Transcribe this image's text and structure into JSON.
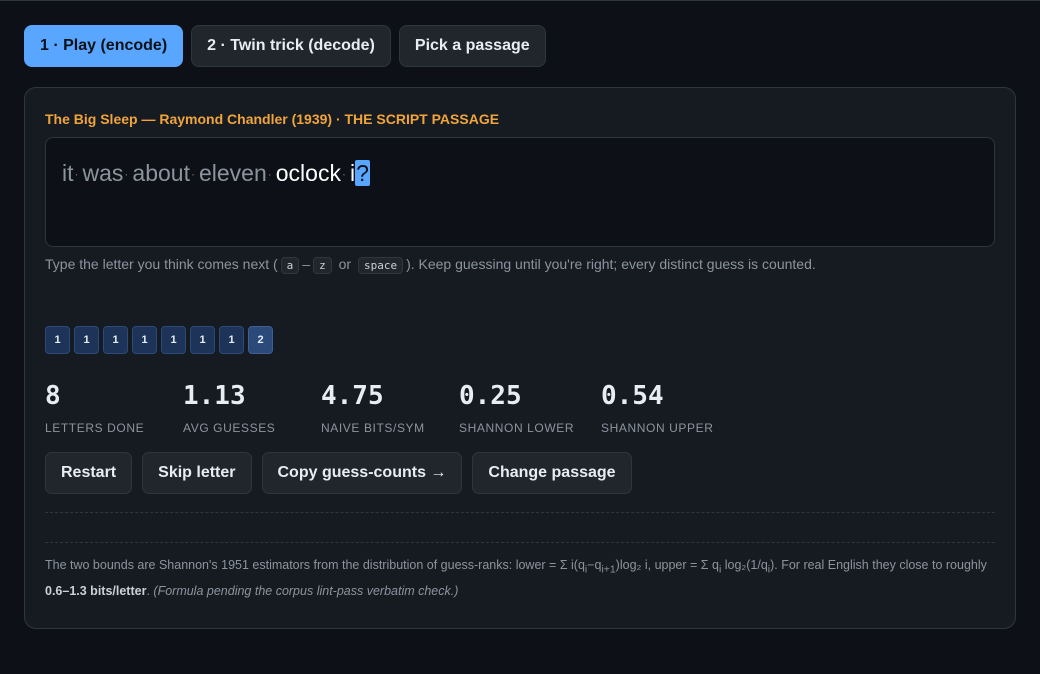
{
  "tabs": [
    {
      "label": "1 · Play (encode)",
      "active": true
    },
    {
      "label": "2 · Twin trick (decode)",
      "active": false
    },
    {
      "label": "Pick a passage",
      "active": false
    }
  ],
  "passage": {
    "source": "The Big Sleep — Raymond Chandler (1939) · THE SCRIPT PASSAGE",
    "words_done": [
      "it",
      "was",
      "about",
      "eleven"
    ],
    "current_word": "oclock",
    "typed": "i",
    "cursor": "?",
    "space_glyph": "·"
  },
  "hint": {
    "prefix": "Type the letter you think comes next (",
    "key_a": "a",
    "dash": "–",
    "key_z": "z",
    "or": "or",
    "key_space": "space",
    "suffix": "). Keep guessing until you're right; every distinct guess is counted."
  },
  "guess_counts": [
    "1",
    "1",
    "1",
    "1",
    "1",
    "1",
    "1",
    "2"
  ],
  "stats": [
    {
      "value": "8",
      "label": "LETTERS DONE"
    },
    {
      "value": "1.13",
      "label": "AVG GUESSES"
    },
    {
      "value": "4.75",
      "label": "NAIVE BITS/SYM"
    },
    {
      "value": "0.25",
      "label": "SHANNON LOWER"
    },
    {
      "value": "0.54",
      "label": "SHANNON UPPER"
    }
  ],
  "actions": {
    "restart": "Restart",
    "skip": "Skip letter",
    "copy": "Copy guess-counts →",
    "change": "Change passage"
  },
  "note": {
    "text1": "The two bounds are Shannon's 1951 estimators from the distribution of guess-ranks: lower = Σ i(q",
    "sub_i": "i",
    "text2": "−q",
    "sub_i1": "i+1",
    "text3": ")log₂ i, upper = Σ q",
    "sub_i2": "i",
    "text4": " log₂(1/q",
    "sub_i3": "i",
    "text5": "). For real English they close to roughly ",
    "range": "0.6–1.3 bits/letter",
    "text6": ". ",
    "pending": "(Formula pending the corpus lint-pass verbatim check.)"
  },
  "colors": {
    "background": "#0d1117",
    "panel": "#161b22",
    "accent": "#58a6ff",
    "source": "#f0a43a"
  }
}
